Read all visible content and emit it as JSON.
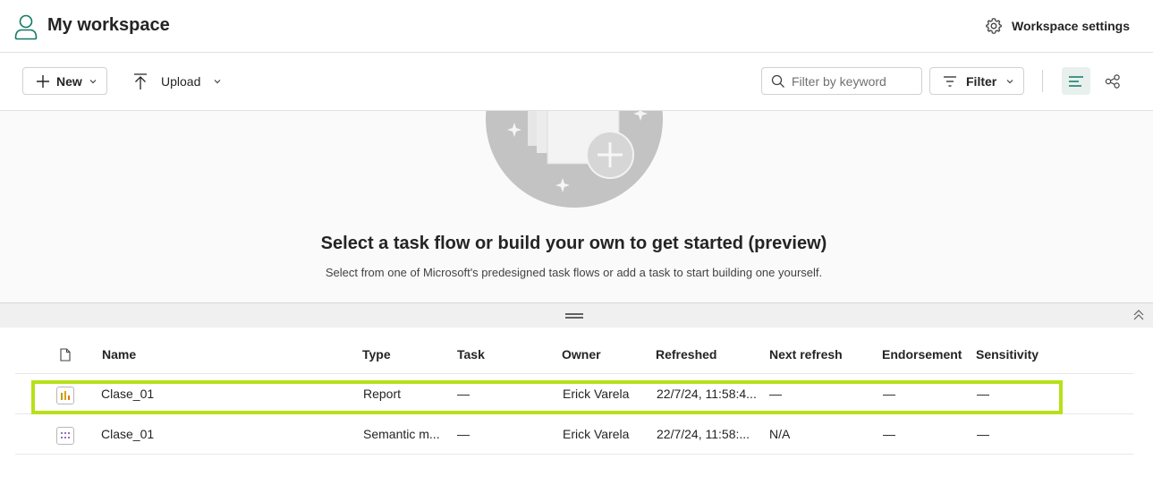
{
  "header": {
    "title": "My workspace",
    "settings_label": "Workspace settings"
  },
  "toolbar": {
    "new_label": "New",
    "upload_label": "Upload",
    "search_placeholder": "Filter by keyword",
    "filter_label": "Filter"
  },
  "taskflow": {
    "title": "Select a task flow or build your own to get started (preview)",
    "subtitle": "Select from one of Microsoft's predesigned task flows or add a task to start building one yourself."
  },
  "table": {
    "columns": [
      "Name",
      "Type",
      "Task",
      "Owner",
      "Refreshed",
      "Next refresh",
      "Endorsement",
      "Sensitivity"
    ],
    "rows": [
      {
        "icon": "report-icon",
        "name": "Clase_01",
        "type": "Report",
        "task": "—",
        "owner": "Erick Varela",
        "refreshed": "22/7/24, 11:58:4...",
        "next_refresh": "—",
        "endorsement": "—",
        "sensitivity": "—",
        "highlighted": true
      },
      {
        "icon": "semantic-model-icon",
        "name": "Clase_01",
        "type": "Semantic m...",
        "task": "—",
        "owner": "Erick Varela",
        "refreshed": "22/7/24, 11:58:...",
        "next_refresh": "N/A",
        "endorsement": "—",
        "sensitivity": "—",
        "highlighted": false
      }
    ]
  },
  "colors": {
    "accent": "#117865",
    "highlight": "#b7e018",
    "report_icon": "#c19c00",
    "semantic_icon": "#8764b8"
  }
}
